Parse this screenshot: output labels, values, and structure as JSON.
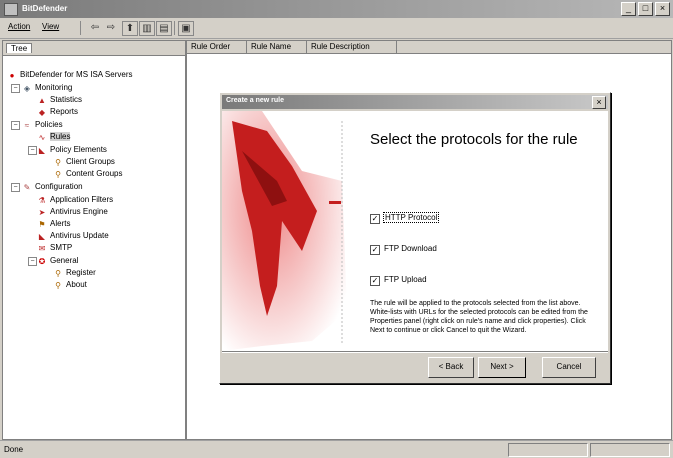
{
  "window": {
    "title": "BitDefender"
  },
  "menu": {
    "items": [
      "Action",
      "View"
    ]
  },
  "toolbar": {
    "icons": [
      "back-icon",
      "forward-icon",
      "up-icon",
      "show-hide-tree-icon",
      "properties-icon",
      "help-icon"
    ]
  },
  "tree": {
    "tab_label": "Tree",
    "items": [
      {
        "label": "BitDefender for MS ISA Servers",
        "icon": "bitdefender-icon"
      },
      {
        "label": "Monitoring",
        "icon": "monitoring-icon"
      },
      {
        "label": "Statistics",
        "icon": "statistics-icon"
      },
      {
        "label": "Reports",
        "icon": "reports-icon"
      },
      {
        "label": "Policies",
        "icon": "policies-icon"
      },
      {
        "label": "Rules",
        "icon": "rules-icon"
      },
      {
        "label": "Policy Elements",
        "icon": "policy-elements-icon"
      },
      {
        "label": "Client Groups",
        "icon": "client-groups-icon"
      },
      {
        "label": "Content Groups",
        "icon": "content-groups-icon"
      },
      {
        "label": "Configuration",
        "icon": "configuration-icon"
      },
      {
        "label": "Application Filters",
        "icon": "application-filters-icon"
      },
      {
        "label": "Antivirus Engine",
        "icon": "antivirus-engine-icon"
      },
      {
        "label": "Alerts",
        "icon": "alerts-icon"
      },
      {
        "label": "Antivirus Update",
        "icon": "antivirus-update-icon"
      },
      {
        "label": "SMTP",
        "icon": "smtp-icon"
      },
      {
        "label": "General",
        "icon": "general-icon"
      },
      {
        "label": "Register",
        "icon": "register-icon"
      },
      {
        "label": "About",
        "icon": "about-icon"
      }
    ]
  },
  "list": {
    "columns": [
      "Rule Order",
      "Rule Name",
      "Rule Description"
    ]
  },
  "dialog": {
    "title": "Create a new rule",
    "heading": "Select the protocols for the rule",
    "protocols": [
      {
        "label": "HTTP Protocol",
        "checked": true
      },
      {
        "label": "FTP Download",
        "checked": true
      },
      {
        "label": "FTP Upload",
        "checked": true
      }
    ],
    "description": "The rule will be applied to the protocols selected from the list above. White-lists with URLs for the selected protocols can be edited from the Properties panel (right click on rule's name and click properties). Click Next to continue or click Cancel to quit the Wizard.",
    "buttons": {
      "back": "< Back",
      "next": "Next >",
      "cancel": "Cancel"
    }
  },
  "status": {
    "text": "Done"
  }
}
